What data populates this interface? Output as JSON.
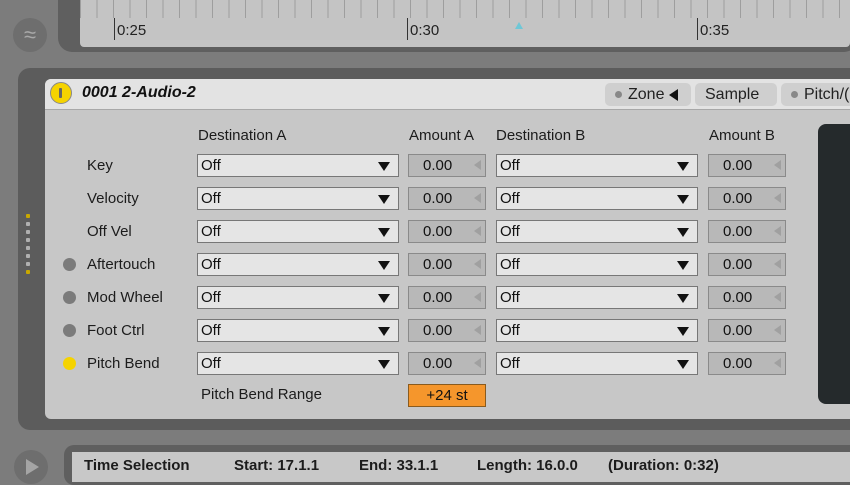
{
  "timeline": {
    "ticks": [
      {
        "label": "0:25"
      },
      {
        "label": "0:30"
      },
      {
        "label": "0:35"
      }
    ]
  },
  "device": {
    "title": "0001 2-Audio-2",
    "tabs": {
      "zone": "Zone",
      "sample": "Sample",
      "pitch": "Pitch/("
    },
    "headers": {
      "dest_a": "Destination A",
      "amount_a": "Amount A",
      "dest_b": "Destination B",
      "amount_b": "Amount B"
    },
    "rows": [
      {
        "label": "Key",
        "dest_a": "Off",
        "amount_a": "0.00",
        "dest_b": "Off",
        "amount_b": "0.00"
      },
      {
        "label": "Velocity",
        "dest_a": "Off",
        "amount_a": "0.00",
        "dest_b": "Off",
        "amount_b": "0.00"
      },
      {
        "label": "Off Vel",
        "dest_a": "Off",
        "amount_a": "0.00",
        "dest_b": "Off",
        "amount_b": "0.00"
      },
      {
        "label": "Aftertouch",
        "dest_a": "Off",
        "amount_a": "0.00",
        "dest_b": "Off",
        "amount_b": "0.00"
      },
      {
        "label": "Mod Wheel",
        "dest_a": "Off",
        "amount_a": "0.00",
        "dest_b": "Off",
        "amount_b": "0.00"
      },
      {
        "label": "Foot Ctrl",
        "dest_a": "Off",
        "amount_a": "0.00",
        "dest_b": "Off",
        "amount_b": "0.00"
      },
      {
        "label": "Pitch Bend",
        "dest_a": "Off",
        "amount_a": "0.00",
        "dest_b": "Off",
        "amount_b": "0.00"
      }
    ],
    "pitch_bend_range": {
      "label": "Pitch Bend Range",
      "value": "+24 st"
    }
  },
  "status": {
    "time_selection": "Time Selection",
    "start": "Start: 17.1.1",
    "end": "End: 33.1.1",
    "length": "Length: 16.0.0",
    "duration": "(Duration: 0:32)"
  },
  "colors": {
    "accent_orange": "#f5962c",
    "led_active": "#f5d300",
    "led_inactive": "#7b7b7b",
    "panel_bg": "#c7c7c7"
  },
  "icons": {
    "app_logo": "waves-icon",
    "power": "power-icon",
    "play": "play-icon",
    "dropdown": "chevron-down-icon"
  }
}
